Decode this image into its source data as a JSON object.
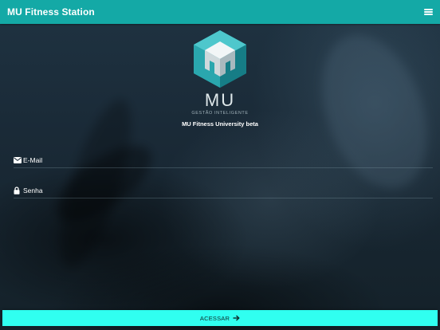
{
  "app_bar": {
    "title": "MU Fitness Station",
    "menu_icon": "hamburger-menu-icon",
    "color": "#14a9a6"
  },
  "logo": {
    "icon": "mu-cube-logo-icon",
    "text": "MU",
    "tagline": "GESTÃO INTELIGENTE"
  },
  "app_name": "MU Fitness University beta",
  "login_form": {
    "email": {
      "label": "E-Mail",
      "icon": "envelope-icon"
    },
    "password": {
      "label": "Senha",
      "icon": "lock-icon"
    },
    "submit": {
      "label": "ACESSAR",
      "icon": "arrow-right-icon",
      "color": "#30fff0"
    }
  }
}
